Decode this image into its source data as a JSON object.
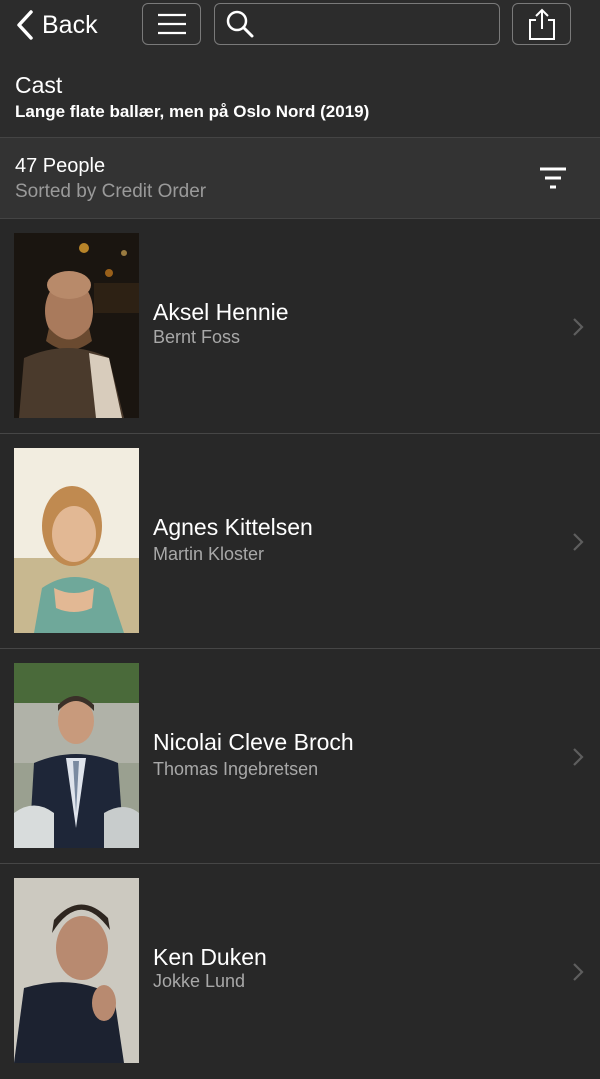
{
  "nav": {
    "back_label": "Back",
    "search_placeholder": ""
  },
  "header": {
    "title": "Cast",
    "subtitle": "Lange flate ballær, men på Oslo Nord (2019)"
  },
  "sort": {
    "count": "47 People",
    "sorted_by": "Sorted by Credit Order"
  },
  "cast": [
    {
      "actor": "Aksel Hennie",
      "role": "Bernt Foss"
    },
    {
      "actor": "Agnes Kittelsen",
      "role": "Martin Kloster"
    },
    {
      "actor": "Nicolai Cleve Broch",
      "role": "Thomas Ingebretsen"
    },
    {
      "actor": "Ken Duken",
      "role": "Jokke Lund"
    }
  ],
  "colors": {
    "background": "#282828",
    "header": "#2c2c2c",
    "sortbar": "#333333",
    "secondary_text": "#a8a8a8"
  }
}
